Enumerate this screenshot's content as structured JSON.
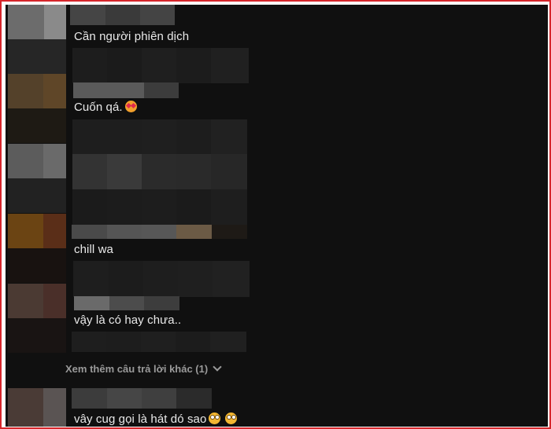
{
  "comments": [
    {
      "text": "Cần người phiên dịch"
    },
    {
      "text": "Cuốn qá.",
      "emoji": "smiling-face-with-hearts-icon"
    },
    {
      "text": "chill wa"
    },
    {
      "text": "vậy là có hay chưa.."
    },
    {
      "text": "vây cug gọi là hát dó sao",
      "emoji": "face-with-rolling-eyes-icon"
    }
  ],
  "see_more": {
    "label": "Xem thêm câu trả lời khác (1)"
  },
  "colors": {
    "background": "#101010",
    "text": "#e9e9e9",
    "muted": "#9a9a9a",
    "frame_border": "#d6262b"
  }
}
